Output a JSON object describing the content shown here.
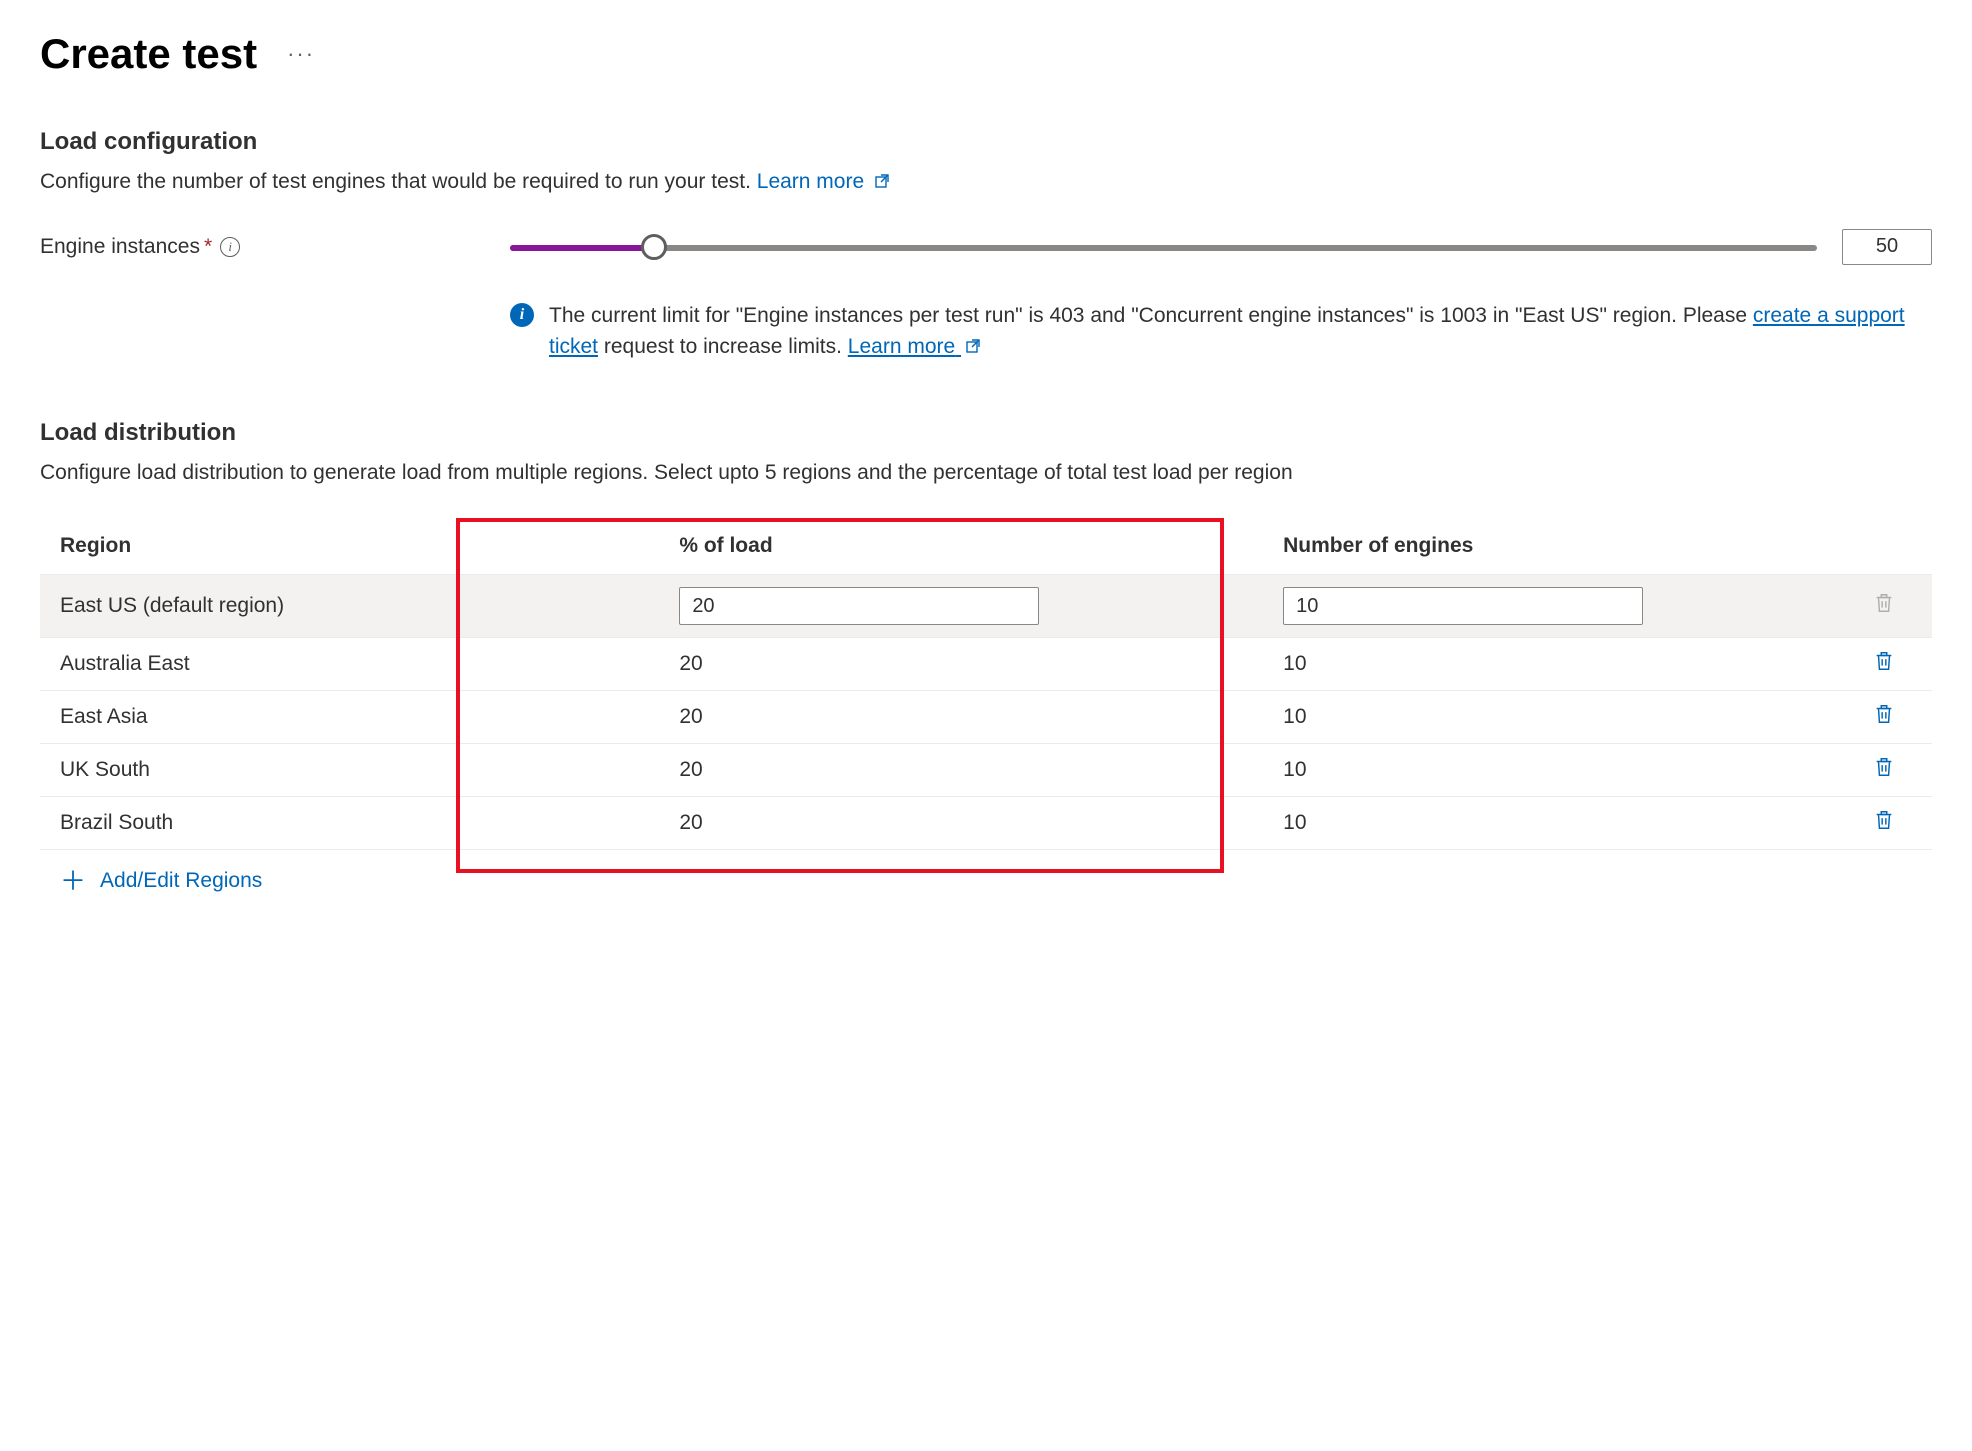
{
  "page": {
    "title": "Create test"
  },
  "load_config": {
    "title": "Load configuration",
    "desc_prefix": "Configure the number of test engines that would be required to run your test. ",
    "learn_more": "Learn more",
    "engine_label": "Engine instances",
    "engine_value": "50",
    "info_prefix": "The current limit for \"Engine instances per test run\" is 403 and \"Concurrent engine instances\" is 1003 in \"East US\" region. Please ",
    "info_link1": "create a support ticket",
    "info_mid": " request to increase limits. ",
    "info_link2": "Learn more"
  },
  "load_dist": {
    "title": "Load distribution",
    "desc": "Configure load distribution to generate load from multiple regions. Select upto 5 regions and the percentage of total test load per region",
    "headers": {
      "region": "Region",
      "pct": "% of load",
      "engines": "Number of engines"
    },
    "rows": [
      {
        "region": "East US (default region)",
        "pct": "20",
        "engines": "10",
        "default": true
      },
      {
        "region": "Australia East",
        "pct": "20",
        "engines": "10",
        "default": false
      },
      {
        "region": "East Asia",
        "pct": "20",
        "engines": "10",
        "default": false
      },
      {
        "region": "UK South",
        "pct": "20",
        "engines": "10",
        "default": false
      },
      {
        "region": "Brazil South",
        "pct": "20",
        "engines": "10",
        "default": false
      }
    ],
    "add_label": "Add/Edit Regions"
  }
}
